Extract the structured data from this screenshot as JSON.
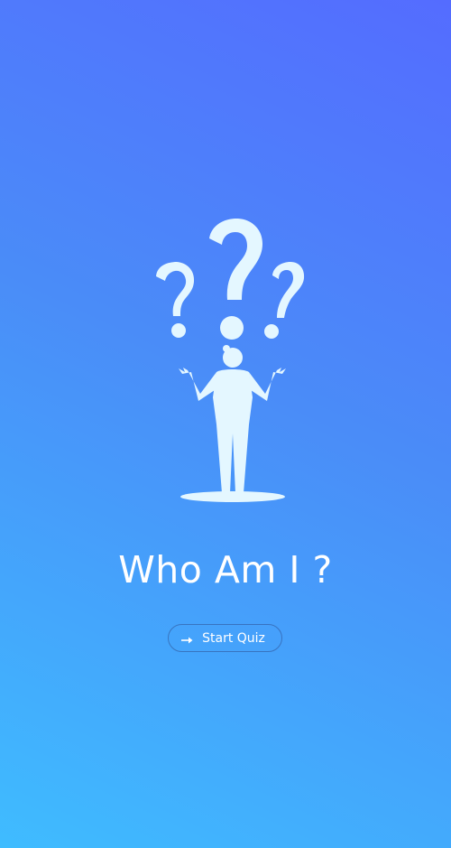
{
  "app": {
    "title": "Who Am I ?",
    "accent_color": "#e4f7ff"
  },
  "hero": {
    "illustration": "person-with-question-marks"
  },
  "actions": {
    "start_label": "Start Quiz",
    "start_icon": "arrow-right-icon"
  }
}
